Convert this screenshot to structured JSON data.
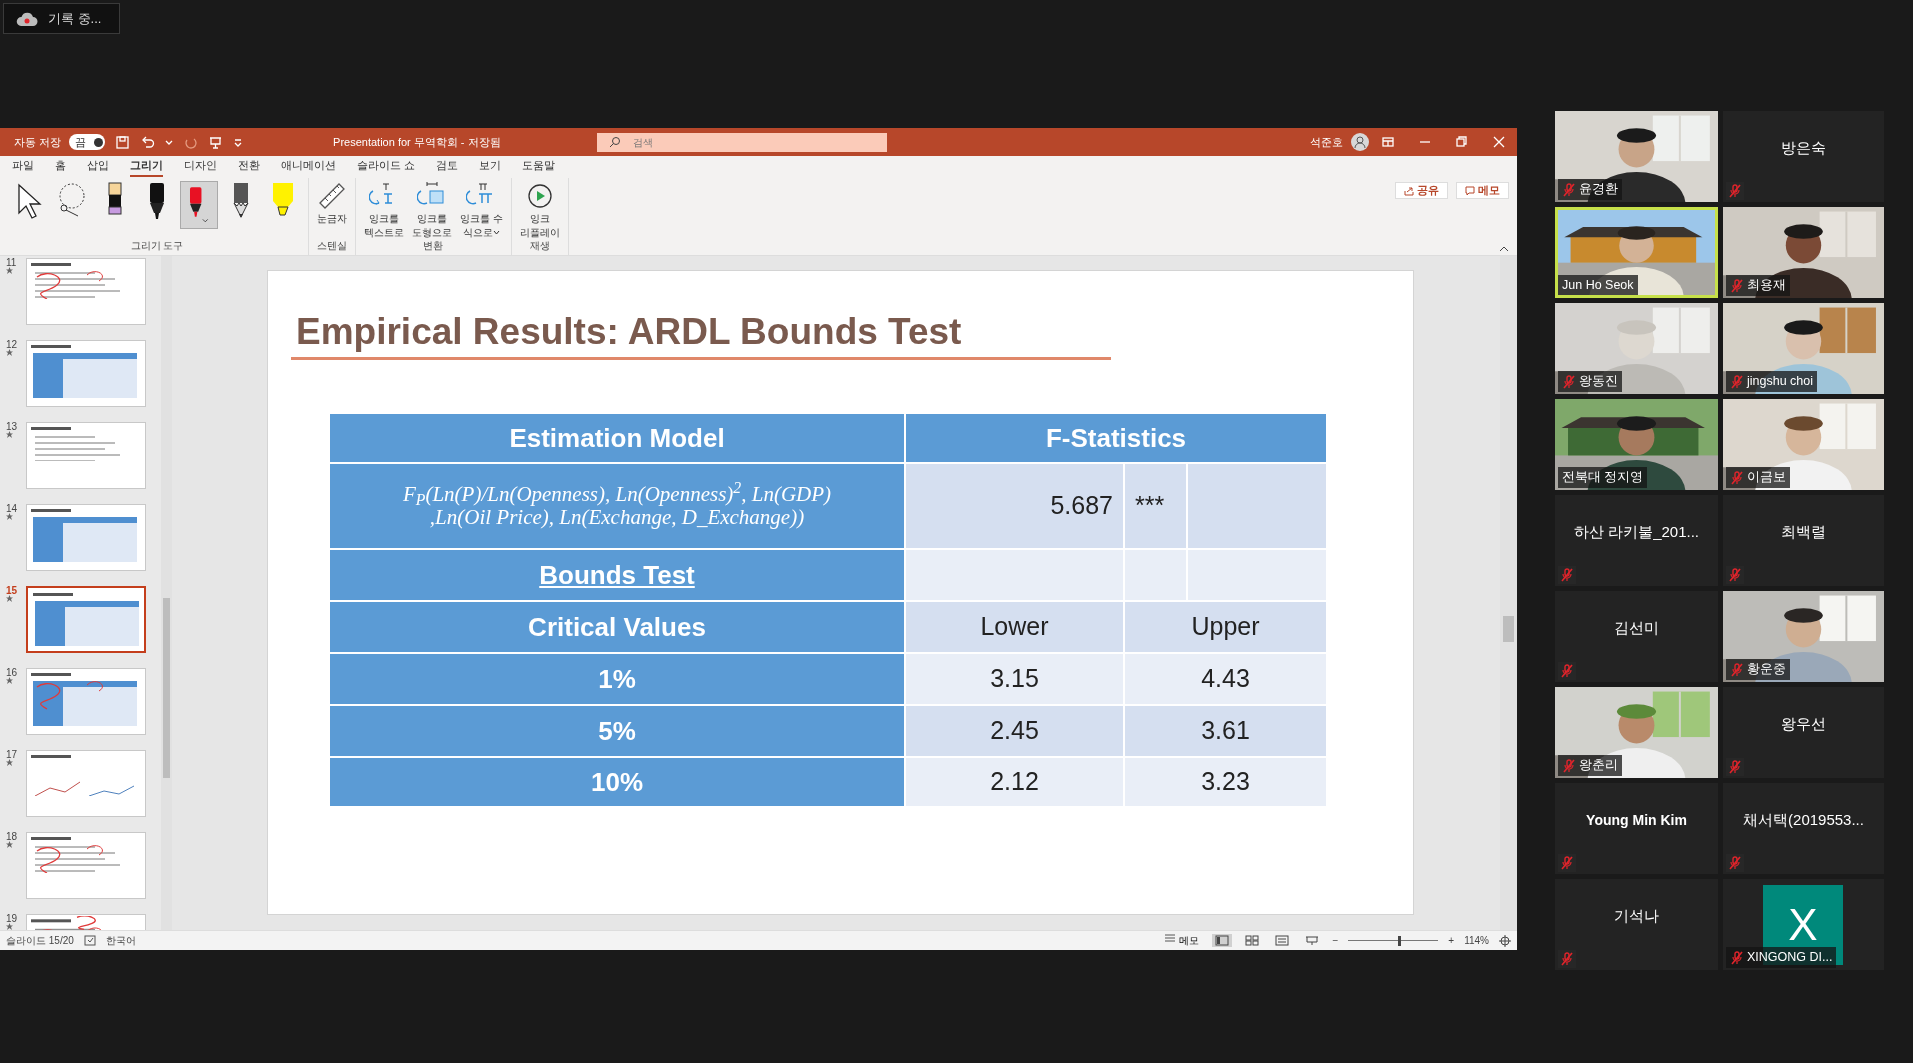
{
  "recording": {
    "label": "기록 중..."
  },
  "app": {
    "title_bar": {
      "autosave_label": "자동 저장",
      "autosave_toggle": {
        "label": "끔"
      },
      "title": "Presentation for 무역학회 - 저장됨",
      "search": {
        "placeholder": "검색"
      },
      "user": "석준호"
    },
    "ribbon_tabs": [
      {
        "label": "파일",
        "selected": false
      },
      {
        "label": "홈",
        "selected": false
      },
      {
        "label": "삽입",
        "selected": false
      },
      {
        "label": "그리기",
        "selected": true
      },
      {
        "label": "디자인",
        "selected": false
      },
      {
        "label": "전환",
        "selected": false
      },
      {
        "label": "애니메이션",
        "selected": false
      },
      {
        "label": "슬라이드 쇼",
        "selected": false
      },
      {
        "label": "검토",
        "selected": false
      },
      {
        "label": "보기",
        "selected": false
      },
      {
        "label": "도움말",
        "selected": false
      }
    ],
    "ribbon_actions": [
      {
        "kind": "share",
        "label": "공유"
      },
      {
        "kind": "comments",
        "label": "메모"
      }
    ],
    "ribbon_groups": [
      {
        "label": "그리기 도구",
        "tools": [
          {
            "kind": "select",
            "selected": false
          },
          {
            "kind": "lasso",
            "selected": false
          },
          {
            "kind": "eraser",
            "selected": false
          },
          {
            "kind": "pen",
            "color": "#111111",
            "selected": false
          },
          {
            "kind": "pen",
            "color": "#e81123",
            "selected": true
          },
          {
            "kind": "pencil",
            "color": "#555555",
            "selected": false
          },
          {
            "kind": "highlighter",
            "color": "#fff200",
            "selected": false
          }
        ]
      },
      {
        "label": "스텐실",
        "buttons": [
          {
            "kind": "ruler",
            "lines": [
              "눈금자"
            ]
          }
        ]
      },
      {
        "label": "변환",
        "buttons": [
          {
            "kind": "ink_to_text",
            "lines": [
              "잉크를",
              "텍스트로"
            ]
          },
          {
            "kind": "ink_to_shape",
            "lines": [
              "잉크를",
              "도형으로"
            ]
          },
          {
            "kind": "ink_to_math",
            "lines": [
              "잉크를 수",
              "식으로"
            ],
            "dropdown": true
          }
        ]
      },
      {
        "label": "재생",
        "buttons": [
          {
            "kind": "replay",
            "lines": [
              "잉크",
              "리플레이"
            ]
          }
        ]
      }
    ],
    "thumbnails": [
      {
        "number": "11",
        "selected": false
      },
      {
        "number": "12",
        "selected": false
      },
      {
        "number": "13",
        "selected": false
      },
      {
        "number": "14",
        "selected": false
      },
      {
        "number": "15",
        "selected": true
      },
      {
        "number": "16",
        "selected": false
      },
      {
        "number": "17",
        "selected": false
      },
      {
        "number": "18",
        "selected": false
      },
      {
        "number": "19",
        "selected": false
      }
    ],
    "slide": {
      "title": "Empirical Results: ARDL Bounds Test",
      "table": {
        "header": [
          "Estimation Model",
          "F-Statistics"
        ],
        "model_row": {
          "formula_lines": [
            "F$_{P}$(Ln(P)/Ln(Openness), Ln(Openness)$^{2}$, Ln(GDP)",
            ",Ln(Oil Price), Ln(Exchange, D_Exchange))"
          ],
          "value": "5.687",
          "significance": "***"
        },
        "bounds_row": {
          "label": "Bounds Test"
        },
        "critical_header": {
          "label": "Critical Values",
          "lower": "Lower",
          "upper": "Upper"
        },
        "rows": [
          {
            "significance_level": "1%",
            "lower": "3.15",
            "upper": "4.43"
          },
          {
            "significance_level": "5%",
            "lower": "2.45",
            "upper": "3.61"
          },
          {
            "significance_level": "10%",
            "lower": "2.12",
            "upper": "3.23"
          }
        ]
      }
    },
    "status_bar": {
      "slide_counter": "슬라이드 15/20",
      "language": "한국어",
      "notes": "메모",
      "views": [
        {
          "kind": "normal",
          "selected": true
        },
        {
          "kind": "sorter",
          "selected": false
        },
        {
          "kind": "reading",
          "selected": false
        },
        {
          "kind": "slideshow",
          "selected": false
        }
      ],
      "zoom_out": "−",
      "zoom_in": "+",
      "zoom_slider": {
        "level": 0.55
      },
      "zoom": "114%"
    }
  },
  "participants": [
    {
      "name": "윤경환",
      "kind": "video",
      "muted": true,
      "speaking": false
    },
    {
      "name": "방은숙",
      "kind": "name",
      "muted": true,
      "speaking": false
    },
    {
      "name": "Jun Ho Seok",
      "kind": "video",
      "muted": false,
      "speaking": true
    },
    {
      "name": "최용재",
      "kind": "video",
      "muted": true,
      "speaking": false
    },
    {
      "name": "왕동진",
      "kind": "video",
      "muted": true,
      "speaking": false
    },
    {
      "name": "jingshu choi",
      "kind": "video",
      "muted": true,
      "speaking": false
    },
    {
      "name": "전북대 정지영",
      "kind": "video",
      "muted": false,
      "speaking": false
    },
    {
      "name": "이금보",
      "kind": "video",
      "muted": true,
      "speaking": false
    },
    {
      "name": "하산 라키불_201...",
      "kind": "name",
      "muted": true,
      "speaking": false
    },
    {
      "name": "최백렬",
      "kind": "name",
      "muted": true,
      "speaking": false
    },
    {
      "name": "김선미",
      "kind": "name",
      "muted": true,
      "speaking": false
    },
    {
      "name": "황운중",
      "kind": "video",
      "muted": true,
      "speaking": false
    },
    {
      "name": "왕춘리",
      "kind": "video",
      "muted": true,
      "speaking": false
    },
    {
      "name": "왕우선",
      "kind": "name",
      "muted": true,
      "speaking": false
    },
    {
      "name": "Young Min Kim",
      "kind": "name",
      "muted": true,
      "speaking": false
    },
    {
      "name": "채서택(2019553...",
      "kind": "name",
      "muted": true,
      "speaking": false
    },
    {
      "name": "기석나",
      "kind": "name",
      "muted": true,
      "speaking": false
    },
    {
      "name": "XINGONG DI...",
      "kind": "avatar",
      "letter": "X",
      "color": "#00897b",
      "muted": true,
      "speaking": false
    }
  ]
}
